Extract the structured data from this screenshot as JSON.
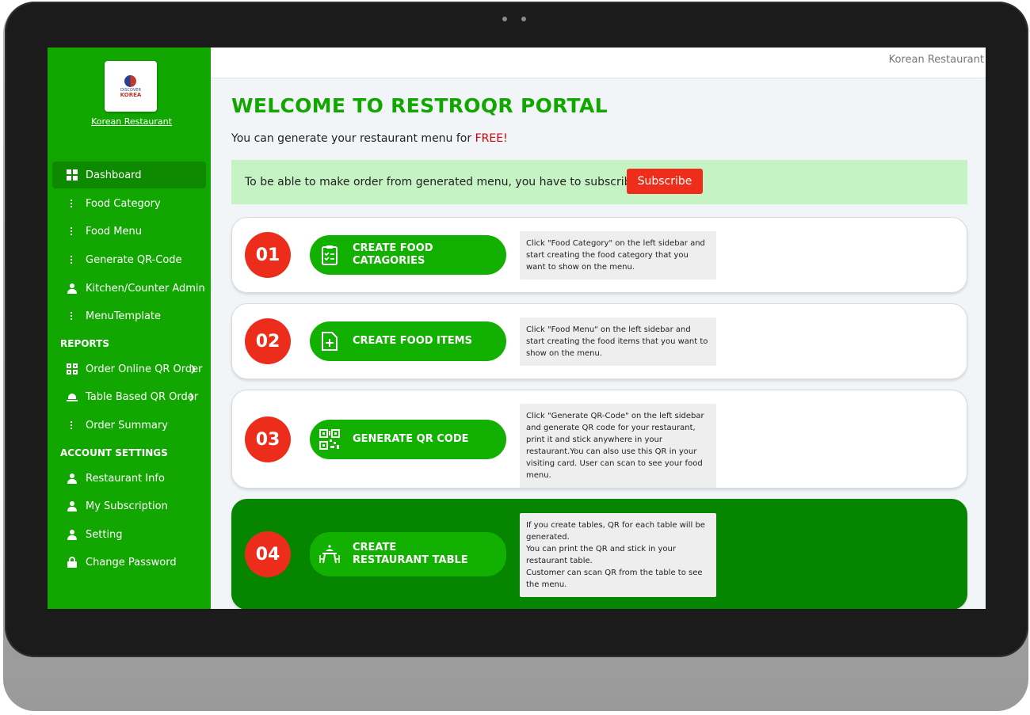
{
  "sidebar": {
    "logo": {
      "line1": "DISCOVER",
      "line2": "KOREA"
    },
    "restaurant_name": "Korean Restaurant",
    "nav": [
      {
        "label": "Dashboard",
        "icon": "dashboard-icon"
      },
      {
        "label": "Food Category",
        "icon": "list-icon"
      },
      {
        "label": "Food Menu",
        "icon": "list-icon"
      },
      {
        "label": "Generate QR-Code",
        "icon": "list-icon"
      },
      {
        "label": "Kitchen/Counter Admin",
        "icon": "user-icon"
      },
      {
        "label": "MenuTemplate",
        "icon": "list-icon"
      }
    ],
    "reports_heading": "REPORTS",
    "reports": [
      {
        "label": "Order Online QR Order",
        "icon": "qr-icon"
      },
      {
        "label": "Table Based QR Order",
        "icon": "bell-icon"
      },
      {
        "label": "Order Summary",
        "icon": "list-icon"
      }
    ],
    "account_heading": "ACCOUNT SETTINGS",
    "account": [
      {
        "label": "Restaurant Info",
        "icon": "user-icon"
      },
      {
        "label": "My Subscription",
        "icon": "user-icon"
      },
      {
        "label": "Setting",
        "icon": "user-icon"
      },
      {
        "label": "Change Password",
        "icon": "lock-icon"
      }
    ]
  },
  "topbar": {
    "restaurant_name": "Korean Restaurant"
  },
  "main": {
    "title": "WELCOME TO RESTROQR PORTAL",
    "subtitle": "You can generate your restaurant menu for",
    "subtitle_highlight": "FREE!",
    "banner_text": "To be able to make order from generated menu, you have to subscribe.",
    "subscribe_label": "Subscribe",
    "steps": [
      {
        "number": "01",
        "action": "CREATE FOOD CATAGORIES",
        "description": "Click \"Food Category\" on the left sidebar and start creating the food category that you want to show on the menu."
      },
      {
        "number": "02",
        "action": "CREATE FOOD ITEMS",
        "description": "Click \"Food Menu\" on the left sidebar and start creating the food items that you want to show on the menu."
      },
      {
        "number": "03",
        "action": "GENERATE QR CODE",
        "description": "Click \"Generate QR-Code\" on the left sidebar and generate QR code for your restaurant, print it and stick anywhere in your restaurant.You can also use this QR in your visiting card. User can scan to see your food menu."
      },
      {
        "number": "04",
        "action": "CREATE RESTAURANT TABLE",
        "description": "If you create tables, QR for each table will be generated.\nYou can print the QR and stick in your restaurant table.\nCustomer can scan QR from the table to see the menu."
      }
    ]
  },
  "colors": {
    "sidebar": "#12a600",
    "accent": "#12a600",
    "danger": "#ed2d1b",
    "banner": "#c6f3c3",
    "dark_step": "#068500"
  }
}
